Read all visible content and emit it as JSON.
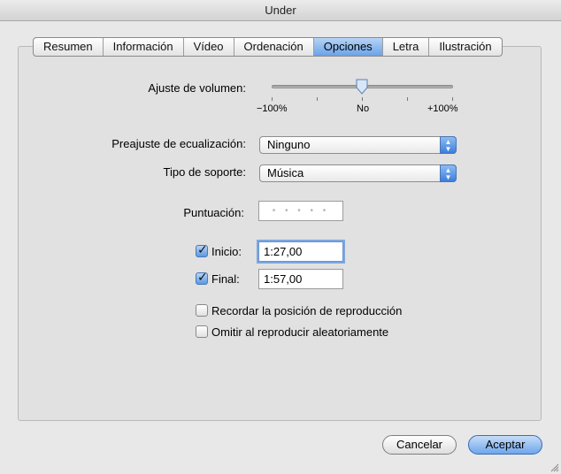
{
  "window": {
    "title": "Under",
    "title_partial_text": "• • • • • • •  •  • • • • •   • • • • • • •"
  },
  "tabs": [
    {
      "label": "Resumen"
    },
    {
      "label": "Información"
    },
    {
      "label": "Vídeo"
    },
    {
      "label": "Ordenación"
    },
    {
      "label": "Opciones",
      "active": true
    },
    {
      "label": "Letra"
    },
    {
      "label": "Ilustración"
    }
  ],
  "volume": {
    "label": "Ajuste de volumen:",
    "value_percent": 0,
    "min_label": "−100%",
    "mid_label": "No",
    "max_label": "+100%"
  },
  "eq": {
    "label": "Preajuste de ecualización:",
    "value": "Ninguno"
  },
  "media_kind": {
    "label": "Tipo de soporte:",
    "value": "Música"
  },
  "rating": {
    "label": "Puntuación:",
    "value_stars": 0,
    "dots": "• • • • •"
  },
  "start": {
    "label": "Inicio:",
    "checked": true,
    "value": "1:27,00"
  },
  "stop": {
    "label": "Final:",
    "checked": true,
    "value": "1:57,00"
  },
  "options": {
    "remember_position": {
      "label": "Recordar la posición de reproducción",
      "checked": false
    },
    "skip_shuffle": {
      "label": "Omitir al reproducir aleatoriamente",
      "checked": false
    }
  },
  "buttons": {
    "cancel": "Cancelar",
    "ok": "Aceptar"
  },
  "colors": {
    "accent": "#5b99e5",
    "window_bg": "#e8e8e8"
  },
  "icons": {
    "check": "✓",
    "popup_arrows": "▲▼"
  }
}
